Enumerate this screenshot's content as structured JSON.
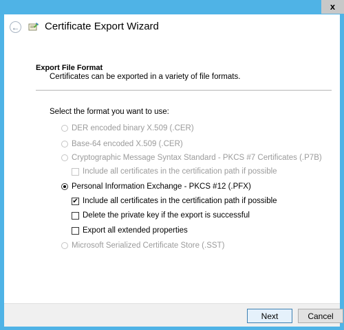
{
  "window": {
    "close_glyph": "x"
  },
  "header": {
    "title": "Certificate Export Wizard",
    "back_icon": "back-arrow-icon",
    "wizard_icon": "certificate-icon"
  },
  "section": {
    "title": "Export File Format",
    "description": "Certificates can be exported in a variety of file formats."
  },
  "prompt": "Select the format you want to use:",
  "options": {
    "der": {
      "label": "DER encoded binary X.509 (.CER)",
      "selected": false,
      "enabled": false
    },
    "base64": {
      "label": "Base-64 encoded X.509 (.CER)",
      "selected": false,
      "enabled": false
    },
    "pkcs7": {
      "label": "Cryptographic Message Syntax Standard - PKCS #7 Certificates (.P7B)",
      "selected": false,
      "enabled": false
    },
    "pkcs7_include": {
      "label": "Include all certificates in the certification path if possible",
      "checked": false,
      "enabled": false
    },
    "pfx": {
      "label": "Personal Information Exchange - PKCS #12 (.PFX)",
      "selected": true,
      "enabled": true
    },
    "pfx_include": {
      "label": "Include all certificates in the certification path if possible",
      "checked": true,
      "enabled": true
    },
    "pfx_delete_key": {
      "label": "Delete the private key if the export is successful",
      "checked": false,
      "enabled": true
    },
    "pfx_export_ext": {
      "label": "Export all extended properties",
      "checked": false,
      "enabled": true
    },
    "sst": {
      "label": "Microsoft Serialized Certificate Store (.SST)",
      "selected": false,
      "enabled": false
    }
  },
  "footer": {
    "next_label": "Next",
    "cancel_label": "Cancel"
  },
  "colors": {
    "frame": "#4fb3e6",
    "disabled_text": "#9b9b9b",
    "footer_bg": "#f0f0f0"
  }
}
